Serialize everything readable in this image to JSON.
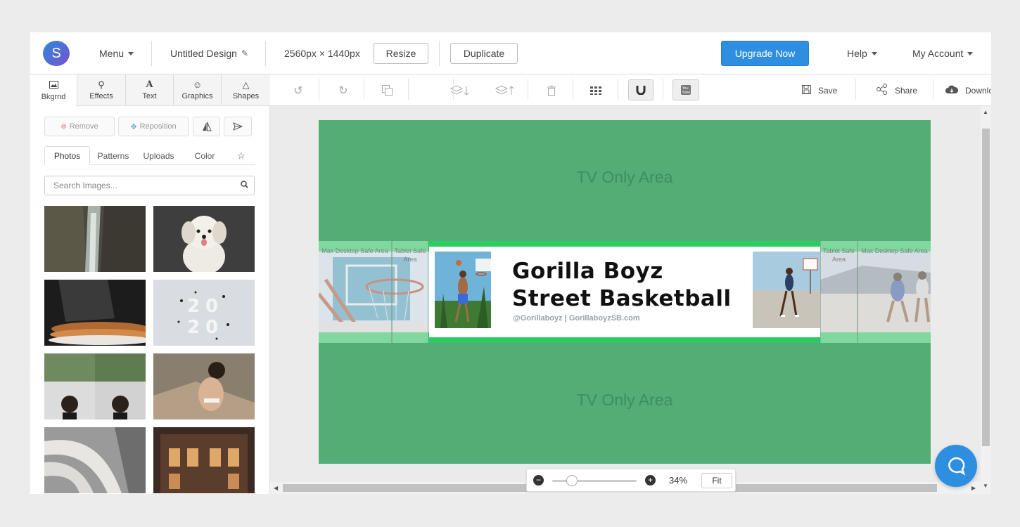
{
  "topbar": {
    "logo_letter": "S",
    "menu_label": "Menu",
    "design_name": "Untitled Design",
    "dimensions": "2560px × 1440px",
    "resize_label": "Resize",
    "duplicate_label": "Duplicate",
    "upgrade_label": "Upgrade Now",
    "help_label": "Help",
    "account_label": "My Account"
  },
  "left_tabs": [
    {
      "label": "Bkgrnd",
      "icon": "image-icon"
    },
    {
      "label": "Effects",
      "icon": "magic-wand-icon"
    },
    {
      "label": "Text",
      "icon": "text-icon"
    },
    {
      "label": "Graphics",
      "icon": "smiley-icon"
    },
    {
      "label": "Shapes",
      "icon": "triangle-icon"
    }
  ],
  "bg_actions": {
    "remove_label": "Remove",
    "reposition_label": "Reposition"
  },
  "photo_tabs": [
    "Photos",
    "Patterns",
    "Uploads",
    "Color"
  ],
  "search": {
    "placeholder": "Search Images..."
  },
  "toolbar_right": {
    "save_label": "Save",
    "share_label": "Share",
    "download_label": "Download"
  },
  "canvas": {
    "tv_area_label": "TV Only Area",
    "max_desktop_label": "Max Desktop Safe Area",
    "tablet_label": "Tablet Safe Area",
    "title_line1": "Gorilla Boyz",
    "title_line2": "Street Basketball",
    "handle": "@Gorillaboyz | GorillaboyzSB.com",
    "canvas_color": "#52ae75",
    "band_color": "#2dcc63"
  },
  "zoom": {
    "percent": "34%",
    "fit_label": "Fit",
    "level": 0.2
  },
  "colors": {
    "accent": "#2e8ee0"
  }
}
